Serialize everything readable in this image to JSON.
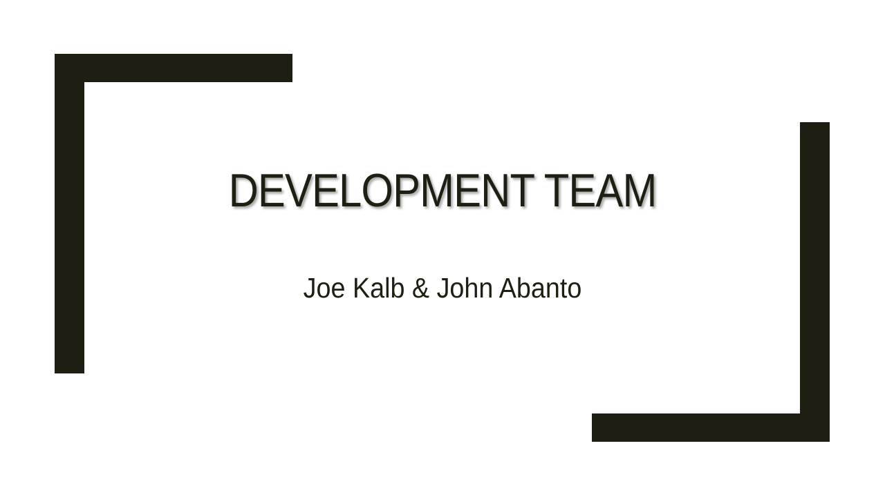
{
  "slide": {
    "title": "DEVELOPMENT TEAM",
    "subtitle": "Joe Kalb & John Abanto"
  },
  "colors": {
    "accent": "#1e1e12",
    "background": "#ffffff"
  }
}
